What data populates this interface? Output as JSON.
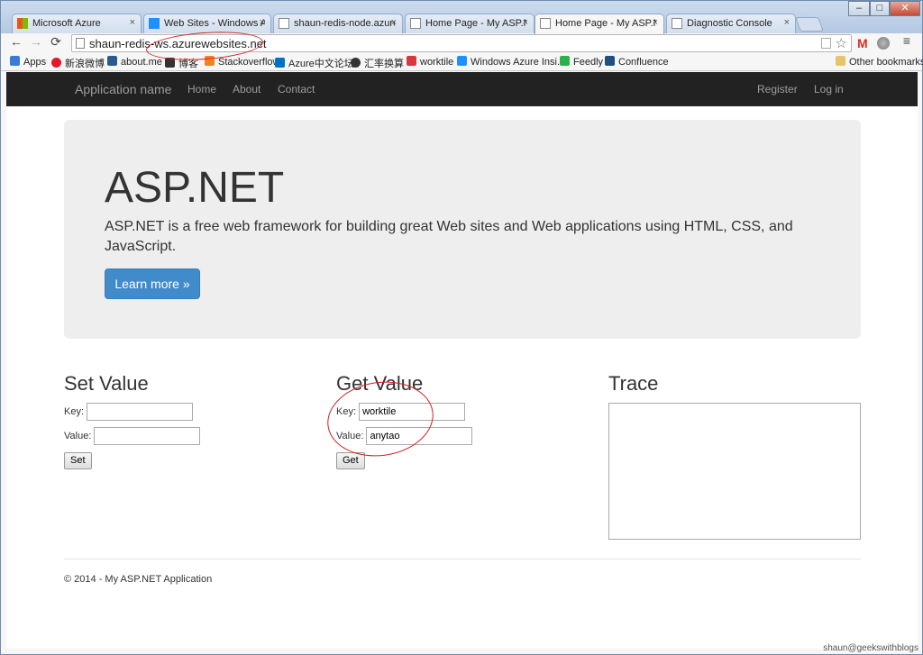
{
  "browser": {
    "tabs": [
      {
        "title": "Microsoft Azure",
        "icon": "azure-grid-icon",
        "color": "#ffb900"
      },
      {
        "title": "Web Sites - Windows Azu",
        "icon": "windows-icon",
        "color": "#1e90ff"
      },
      {
        "title": "shaun-redis-node.azurew",
        "icon": "page-icon",
        "color": "#888888"
      },
      {
        "title": "Home Page - My ASP.NET",
        "icon": "page-icon",
        "color": "#888888"
      },
      {
        "title": "Home Page - My ASP.NET",
        "icon": "page-icon",
        "color": "#888888",
        "active": true
      },
      {
        "title": "Diagnostic Console",
        "icon": "page-icon",
        "color": "#888888"
      }
    ],
    "tab_close": "×",
    "url": "shaun-redis-ws.azurewebsites.net",
    "window_controls": {
      "minimize": "–",
      "maximize": "□",
      "close": "✕"
    },
    "nav": {
      "back": "←",
      "forward": "→",
      "reload": "⟳",
      "menu": "≡",
      "star": "☆",
      "gmail": "M"
    },
    "bookmarks": [
      {
        "label": "Apps",
        "color": "#3a7bd5"
      },
      {
        "label": "新浪微博",
        "color": "#e6162d"
      },
      {
        "label": "about.me",
        "color": "#2a5b8f"
      },
      {
        "label": "博客",
        "color": "#333333"
      },
      {
        "label": "Stackoverflow",
        "color": "#f48024"
      },
      {
        "label": "Azure中文论坛",
        "color": "#0072c6"
      },
      {
        "label": "汇率换算",
        "color": "#333333"
      },
      {
        "label": "worktile",
        "color": "#d9363e"
      },
      {
        "label": "Windows Azure Insi...",
        "color": "#1e90ff"
      },
      {
        "label": "Feedly",
        "color": "#2bb24c"
      },
      {
        "label": "Confluence",
        "color": "#205081"
      }
    ],
    "other_bookmarks": "Other bookmarks"
  },
  "navbar": {
    "brand": "Application name",
    "links": [
      "Home",
      "About",
      "Contact"
    ],
    "register": "Register",
    "login": "Log in"
  },
  "jumbotron": {
    "title": "ASP.NET",
    "lead": "ASP.NET is a free web framework for building great Web sites and Web applications using HTML, CSS, and JavaScript.",
    "button": "Learn more »"
  },
  "set_value": {
    "heading": "Set Value",
    "key_label": "Key:",
    "key_value": "",
    "value_label": "Value:",
    "value_value": "",
    "button": "Set"
  },
  "get_value": {
    "heading": "Get Value",
    "key_label": "Key:",
    "key_value": "worktile",
    "value_label": "Value:",
    "value_value": "anytao",
    "button": "Get"
  },
  "trace": {
    "heading": "Trace",
    "content": ""
  },
  "footer": "© 2014 - My ASP.NET Application",
  "watermark": "shaun@geekswithblogs"
}
